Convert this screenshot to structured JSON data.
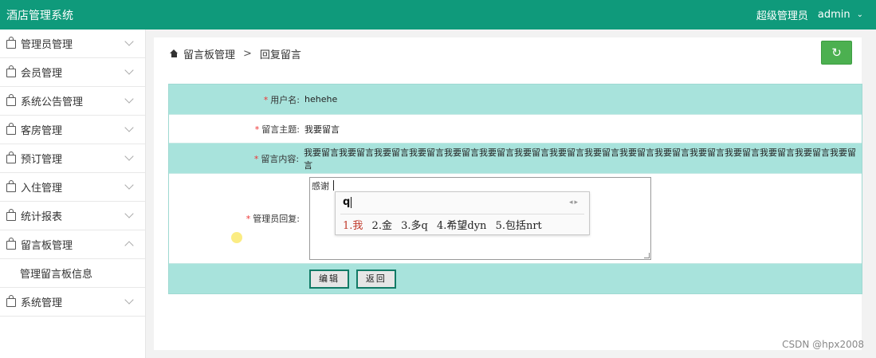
{
  "app": {
    "title": "酒店管理系统"
  },
  "user": {
    "role": "超级管理员",
    "name": "admin"
  },
  "sidebar": {
    "items": [
      {
        "label": "管理员管理",
        "expanded": false
      },
      {
        "label": "会员管理",
        "expanded": false
      },
      {
        "label": "系统公告管理",
        "expanded": false
      },
      {
        "label": "客房管理",
        "expanded": false
      },
      {
        "label": "预订管理",
        "expanded": false
      },
      {
        "label": "入住管理",
        "expanded": false
      },
      {
        "label": "统计报表",
        "expanded": false
      },
      {
        "label": "留言板管理",
        "expanded": true,
        "sub": [
          "管理留言板信息"
        ]
      },
      {
        "label": "系统管理",
        "expanded": false
      }
    ]
  },
  "breadcrumb": {
    "home": "留言板管理",
    "sep": ">",
    "current": "回复留言"
  },
  "icons": {
    "home": "home-icon",
    "refresh": "refresh-icon",
    "menu": "bag-icon"
  },
  "form": {
    "username_label": "用户名:",
    "username": "hehehe",
    "subject_label": "留言主题:",
    "subject": "我要留言",
    "content_label": "留言内容:",
    "content": "我要留言我要留言我要留言我要留言我要留言我要留言我要留言我要留言我要留言我要留言我要留言我要留言我要留言我要留言我要留言我要留言",
    "reply_label": "管理员回复:",
    "reply_value": "感谢",
    "edit_btn": "编辑",
    "back_btn": "返回"
  },
  "ime": {
    "composition": "q",
    "candidates": [
      "1.我",
      "2.金",
      "3.多q",
      "4.希望dyn",
      "5.包括nrt"
    ]
  },
  "watermark": "CSDN @hpx2008",
  "colors": {
    "topbar": "#0f9a7b",
    "row_teal": "#a8e3dc",
    "refresh": "#4cb050",
    "required": "#e33333"
  }
}
